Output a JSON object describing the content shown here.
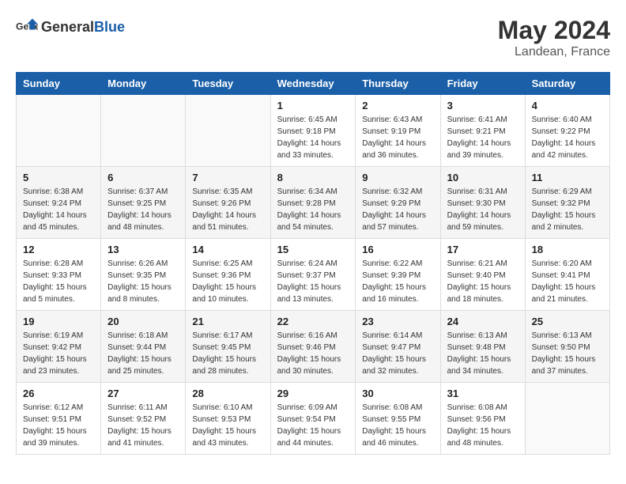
{
  "header": {
    "logo_general": "General",
    "logo_blue": "Blue",
    "title": "May 2024",
    "subtitle": "Landean, France"
  },
  "columns": [
    "Sunday",
    "Monday",
    "Tuesday",
    "Wednesday",
    "Thursday",
    "Friday",
    "Saturday"
  ],
  "weeks": [
    [
      {
        "day": "",
        "info": ""
      },
      {
        "day": "",
        "info": ""
      },
      {
        "day": "",
        "info": ""
      },
      {
        "day": "1",
        "info": "Sunrise: 6:45 AM\nSunset: 9:18 PM\nDaylight: 14 hours\nand 33 minutes."
      },
      {
        "day": "2",
        "info": "Sunrise: 6:43 AM\nSunset: 9:19 PM\nDaylight: 14 hours\nand 36 minutes."
      },
      {
        "day": "3",
        "info": "Sunrise: 6:41 AM\nSunset: 9:21 PM\nDaylight: 14 hours\nand 39 minutes."
      },
      {
        "day": "4",
        "info": "Sunrise: 6:40 AM\nSunset: 9:22 PM\nDaylight: 14 hours\nand 42 minutes."
      }
    ],
    [
      {
        "day": "5",
        "info": "Sunrise: 6:38 AM\nSunset: 9:24 PM\nDaylight: 14 hours\nand 45 minutes."
      },
      {
        "day": "6",
        "info": "Sunrise: 6:37 AM\nSunset: 9:25 PM\nDaylight: 14 hours\nand 48 minutes."
      },
      {
        "day": "7",
        "info": "Sunrise: 6:35 AM\nSunset: 9:26 PM\nDaylight: 14 hours\nand 51 minutes."
      },
      {
        "day": "8",
        "info": "Sunrise: 6:34 AM\nSunset: 9:28 PM\nDaylight: 14 hours\nand 54 minutes."
      },
      {
        "day": "9",
        "info": "Sunrise: 6:32 AM\nSunset: 9:29 PM\nDaylight: 14 hours\nand 57 minutes."
      },
      {
        "day": "10",
        "info": "Sunrise: 6:31 AM\nSunset: 9:30 PM\nDaylight: 14 hours\nand 59 minutes."
      },
      {
        "day": "11",
        "info": "Sunrise: 6:29 AM\nSunset: 9:32 PM\nDaylight: 15 hours\nand 2 minutes."
      }
    ],
    [
      {
        "day": "12",
        "info": "Sunrise: 6:28 AM\nSunset: 9:33 PM\nDaylight: 15 hours\nand 5 minutes."
      },
      {
        "day": "13",
        "info": "Sunrise: 6:26 AM\nSunset: 9:35 PM\nDaylight: 15 hours\nand 8 minutes."
      },
      {
        "day": "14",
        "info": "Sunrise: 6:25 AM\nSunset: 9:36 PM\nDaylight: 15 hours\nand 10 minutes."
      },
      {
        "day": "15",
        "info": "Sunrise: 6:24 AM\nSunset: 9:37 PM\nDaylight: 15 hours\nand 13 minutes."
      },
      {
        "day": "16",
        "info": "Sunrise: 6:22 AM\nSunset: 9:39 PM\nDaylight: 15 hours\nand 16 minutes."
      },
      {
        "day": "17",
        "info": "Sunrise: 6:21 AM\nSunset: 9:40 PM\nDaylight: 15 hours\nand 18 minutes."
      },
      {
        "day": "18",
        "info": "Sunrise: 6:20 AM\nSunset: 9:41 PM\nDaylight: 15 hours\nand 21 minutes."
      }
    ],
    [
      {
        "day": "19",
        "info": "Sunrise: 6:19 AM\nSunset: 9:42 PM\nDaylight: 15 hours\nand 23 minutes."
      },
      {
        "day": "20",
        "info": "Sunrise: 6:18 AM\nSunset: 9:44 PM\nDaylight: 15 hours\nand 25 minutes."
      },
      {
        "day": "21",
        "info": "Sunrise: 6:17 AM\nSunset: 9:45 PM\nDaylight: 15 hours\nand 28 minutes."
      },
      {
        "day": "22",
        "info": "Sunrise: 6:16 AM\nSunset: 9:46 PM\nDaylight: 15 hours\nand 30 minutes."
      },
      {
        "day": "23",
        "info": "Sunrise: 6:14 AM\nSunset: 9:47 PM\nDaylight: 15 hours\nand 32 minutes."
      },
      {
        "day": "24",
        "info": "Sunrise: 6:13 AM\nSunset: 9:48 PM\nDaylight: 15 hours\nand 34 minutes."
      },
      {
        "day": "25",
        "info": "Sunrise: 6:13 AM\nSunset: 9:50 PM\nDaylight: 15 hours\nand 37 minutes."
      }
    ],
    [
      {
        "day": "26",
        "info": "Sunrise: 6:12 AM\nSunset: 9:51 PM\nDaylight: 15 hours\nand 39 minutes."
      },
      {
        "day": "27",
        "info": "Sunrise: 6:11 AM\nSunset: 9:52 PM\nDaylight: 15 hours\nand 41 minutes."
      },
      {
        "day": "28",
        "info": "Sunrise: 6:10 AM\nSunset: 9:53 PM\nDaylight: 15 hours\nand 43 minutes."
      },
      {
        "day": "29",
        "info": "Sunrise: 6:09 AM\nSunset: 9:54 PM\nDaylight: 15 hours\nand 44 minutes."
      },
      {
        "day": "30",
        "info": "Sunrise: 6:08 AM\nSunset: 9:55 PM\nDaylight: 15 hours\nand 46 minutes."
      },
      {
        "day": "31",
        "info": "Sunrise: 6:08 AM\nSunset: 9:56 PM\nDaylight: 15 hours\nand 48 minutes."
      },
      {
        "day": "",
        "info": ""
      }
    ]
  ]
}
